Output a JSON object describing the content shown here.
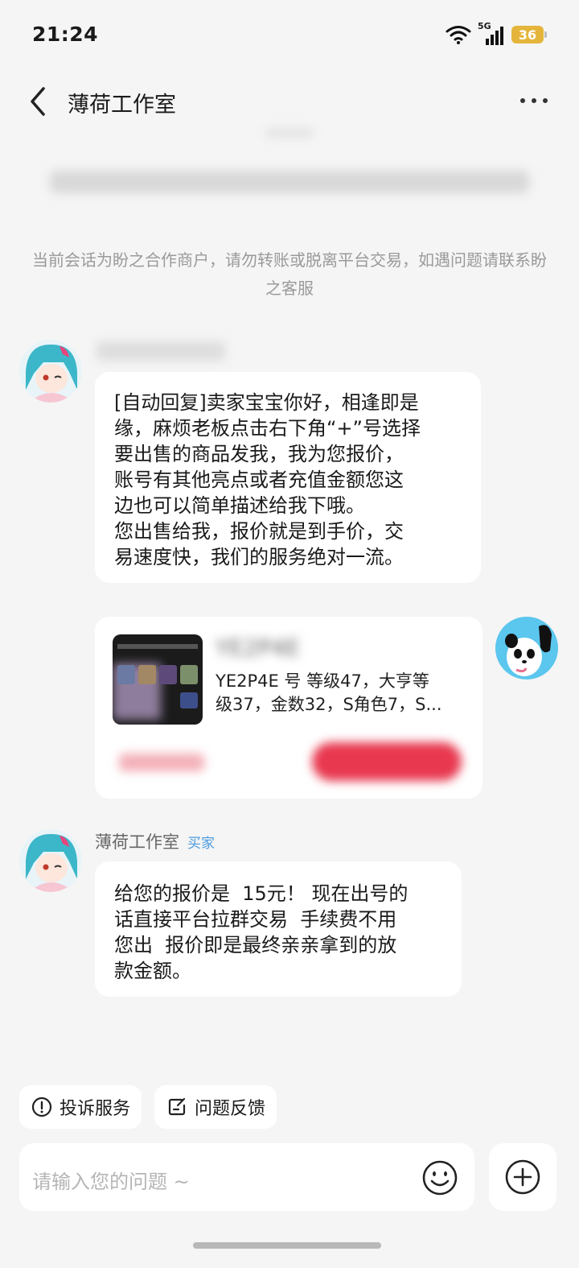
{
  "status_bar": {
    "time": "21:24",
    "network": "5G",
    "battery": "36"
  },
  "header": {
    "title": "薄荷工作室"
  },
  "notice": "当前会话为盼之合作商户，请勿转账或脱离平台交易，如遇问题请联系盼之客服",
  "messages": [
    {
      "sender": "",
      "text": "[自动回复]卖家宝宝你好，相逢即是\n缘，麻烦老板点击右下角“+”号选择\n要出售的商品发我，我为您报价，\n账号有其他亮点或者充值金额您这\n边也可以简单描述给我下哦。\n您出售给我，报价就是到手价，交\n易速度快，我们的服务绝对一流。"
    },
    {
      "product_card": {
        "id_partial": "YE2P4E",
        "desc_line1": "YE2P4E 号 等级47，大亨等",
        "desc_line2": "级37，金数32，S角色7，S..."
      }
    },
    {
      "sender": "薄荷工作室",
      "tag": "买家",
      "text": "给您的报价是  15元！ 现在出号的\n话直接平台拉群交易  手续费不用\n您出  报价即是最终亲亲拿到的放\n款金额。"
    }
  ],
  "actions": {
    "complaint": "投诉服务",
    "feedback": "问题反馈"
  },
  "input": {
    "placeholder": "请输入您的问题 ~"
  },
  "colors": {
    "accent_blue": "#4a9be0",
    "red_button": "#e8384f",
    "battery": "#e4b53a"
  }
}
